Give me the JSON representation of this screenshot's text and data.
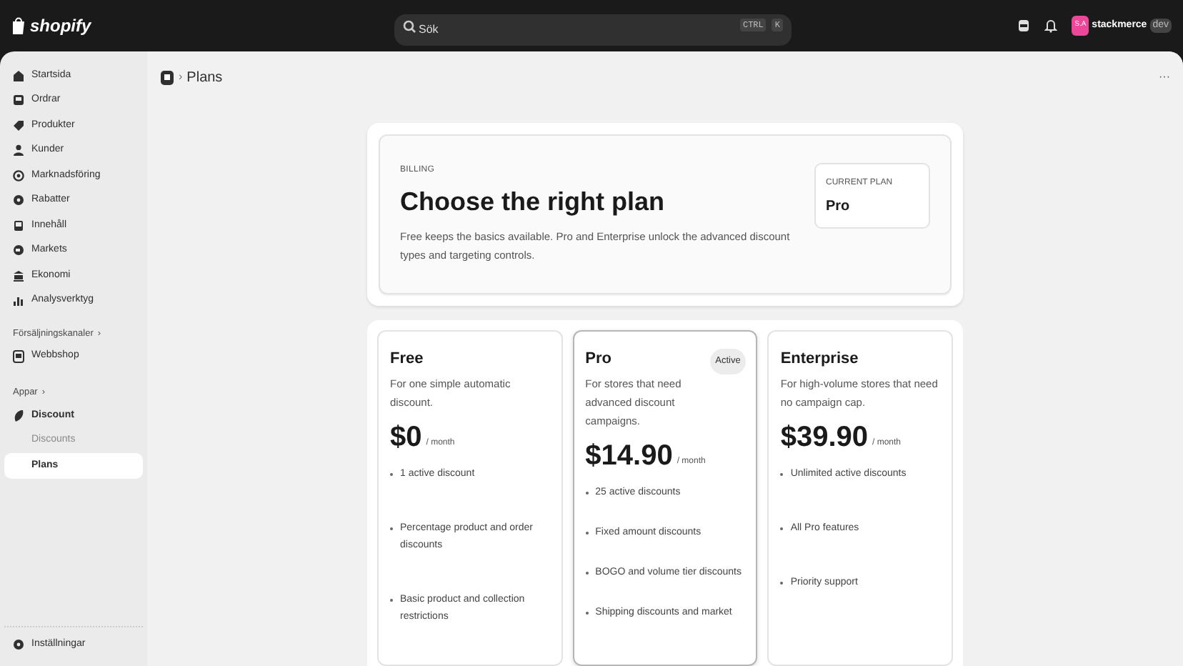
{
  "topbar": {
    "logo": "shopify",
    "search": {
      "placeholder": "Sök",
      "shortcut": [
        "CTRL",
        "K"
      ]
    },
    "store": {
      "initials": "S.A",
      "name": "stackmerce",
      "badge": "dev"
    }
  },
  "sidebar": {
    "items": [
      {
        "label": "Startsida",
        "selected": false
      },
      {
        "label": "Ordrar",
        "selected": false
      },
      {
        "label": "Produkter",
        "selected": false
      },
      {
        "label": "Kunder",
        "selected": false
      },
      {
        "label": "Marknadsföring",
        "selected": false
      },
      {
        "label": "Rabatter",
        "selected": false
      },
      {
        "label": "Innehåll",
        "selected": false
      },
      {
        "label": "Markets",
        "selected": false
      },
      {
        "label": "Ekonomi",
        "selected": false
      },
      {
        "label": "Analysverktyg",
        "selected": false
      }
    ],
    "channels": {
      "heading": "Försäljningskanaler",
      "chevron": "›",
      "items": [
        {
          "label": "Webbshop",
          "selected": false
        }
      ]
    },
    "apps": {
      "heading": "Appar",
      "chevron": "›",
      "app": "Discount",
      "items": [
        {
          "label": "Discounts",
          "selected": false
        },
        {
          "label": "Plans",
          "selected": true
        }
      ]
    },
    "settings": "Inställningar"
  },
  "page": {
    "separator": "›",
    "title": "Plans",
    "more": "···"
  },
  "billing": {
    "eyebrow": "BILLING",
    "title": "Choose the right plan",
    "description": "Free keeps the basics available. Pro and Enterprise unlock the advanced discount types and targeting controls.",
    "current_label": "CURRENT PLAN",
    "current_value": "Pro"
  },
  "plans": [
    {
      "name": "Free",
      "description": "For one simple automatic discount.",
      "price": "$0",
      "period": "/ month",
      "selected": false,
      "features": [
        "1 active discount",
        "Percentage product and order discounts",
        "Basic product and collection restrictions"
      ]
    },
    {
      "name": "Pro",
      "description": "For stores that need advanced discount campaigns.",
      "price": "$14.90",
      "period": "/ month",
      "selected": true,
      "badge": "Active",
      "features": [
        "25 active discounts",
        "Fixed amount discounts",
        "BOGO and volume tier discounts",
        "Shipping discounts and market"
      ]
    },
    {
      "name": "Enterprise",
      "description": "For high-volume stores that need no campaign cap.",
      "price": "$39.90",
      "period": "/ month",
      "selected": false,
      "features": [
        "Unlimited active discounts",
        "All Pro features",
        "Priority support"
      ]
    }
  ]
}
